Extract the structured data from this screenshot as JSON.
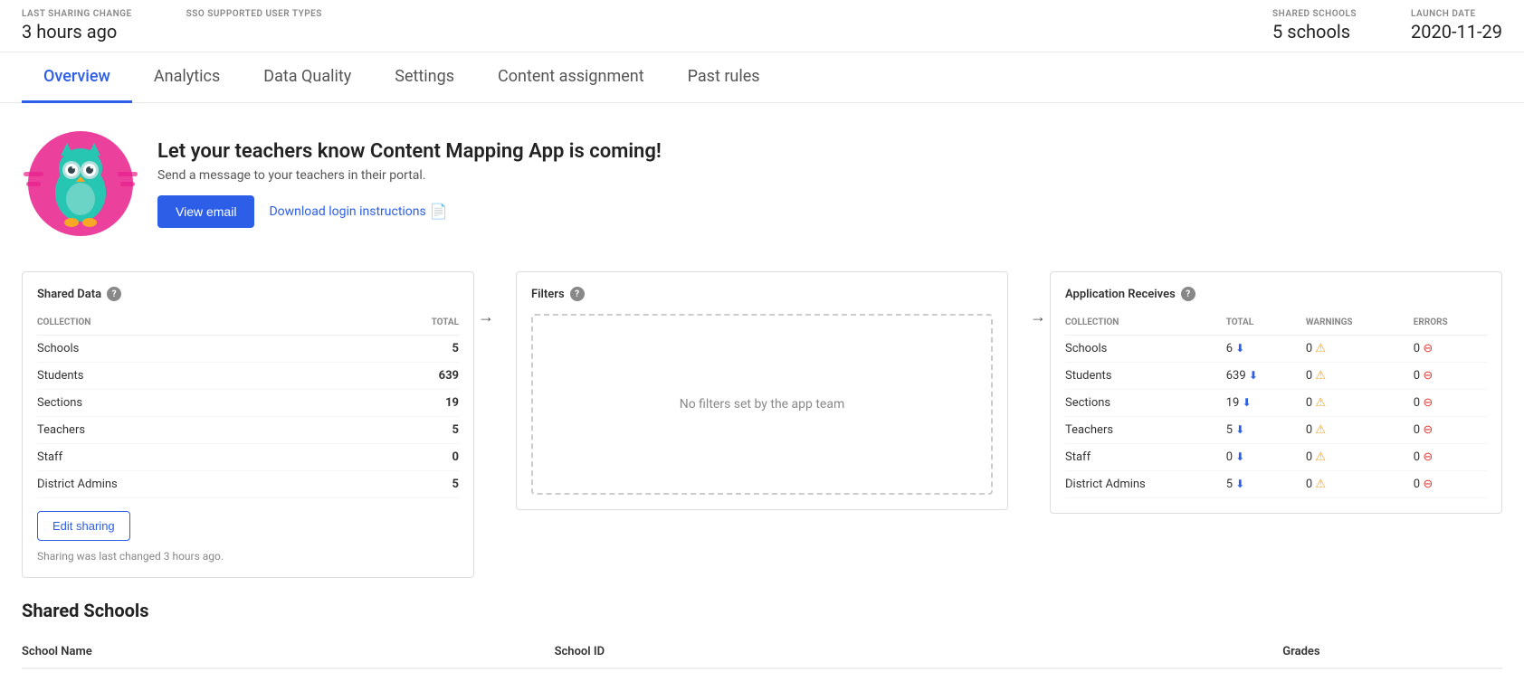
{
  "statsBar": {
    "lastSharing": {
      "label": "LAST SHARING CHANGE",
      "value": "3 hours ago"
    },
    "sso": {
      "label": "SSO SUPPORTED USER TYPES",
      "value": ""
    },
    "sharedSchools": {
      "label": "SHARED SCHOOLS",
      "value": "5 schools"
    },
    "launchDate": {
      "label": "LAUNCH DATE",
      "value": "2020-11-29"
    }
  },
  "tabs": [
    {
      "label": "Overview",
      "active": true
    },
    {
      "label": "Analytics",
      "active": false
    },
    {
      "label": "Data Quality",
      "active": false
    },
    {
      "label": "Settings",
      "active": false
    },
    {
      "label": "Content assignment",
      "active": false
    },
    {
      "label": "Past rules",
      "active": false
    }
  ],
  "promo": {
    "heading": "Let your teachers know Content Mapping App is coming!",
    "subtext": "Send a message to your teachers in their portal.",
    "viewEmailBtn": "View email",
    "downloadLink": "Download login instructions"
  },
  "sharedData": {
    "sectionTitle": "Shared Data",
    "colCollection": "COLLECTION",
    "colTotal": "TOTAL",
    "rows": [
      {
        "collection": "Schools",
        "total": "5"
      },
      {
        "collection": "Students",
        "total": "639"
      },
      {
        "collection": "Sections",
        "total": "19"
      },
      {
        "collection": "Teachers",
        "total": "5"
      },
      {
        "collection": "Staff",
        "total": "0"
      },
      {
        "collection": "District Admins",
        "total": "5"
      }
    ],
    "editBtn": "Edit sharing",
    "sharingNote": "Sharing was last changed 3 hours ago."
  },
  "filters": {
    "sectionTitle": "Filters",
    "emptyMessage": "No filters set by the app team"
  },
  "appReceives": {
    "sectionTitle": "Application Receives",
    "colCollection": "COLLECTION",
    "colTotal": "TOTAL",
    "colWarnings": "WARNINGS",
    "colErrors": "ERRORS",
    "rows": [
      {
        "collection": "Schools",
        "total": "6",
        "warnings": "0",
        "errors": "0"
      },
      {
        "collection": "Students",
        "total": "639",
        "warnings": "0",
        "errors": "0"
      },
      {
        "collection": "Sections",
        "total": "19",
        "warnings": "0",
        "errors": "0"
      },
      {
        "collection": "Teachers",
        "total": "5",
        "warnings": "0",
        "errors": "0"
      },
      {
        "collection": "Staff",
        "total": "0",
        "warnings": "0",
        "errors": "0"
      },
      {
        "collection": "District Admins",
        "total": "5",
        "warnings": "0",
        "errors": "0"
      }
    ]
  },
  "sharedSchools": {
    "heading": "Shared Schools",
    "columns": [
      "School Name",
      "School ID",
      "Grades"
    ]
  }
}
